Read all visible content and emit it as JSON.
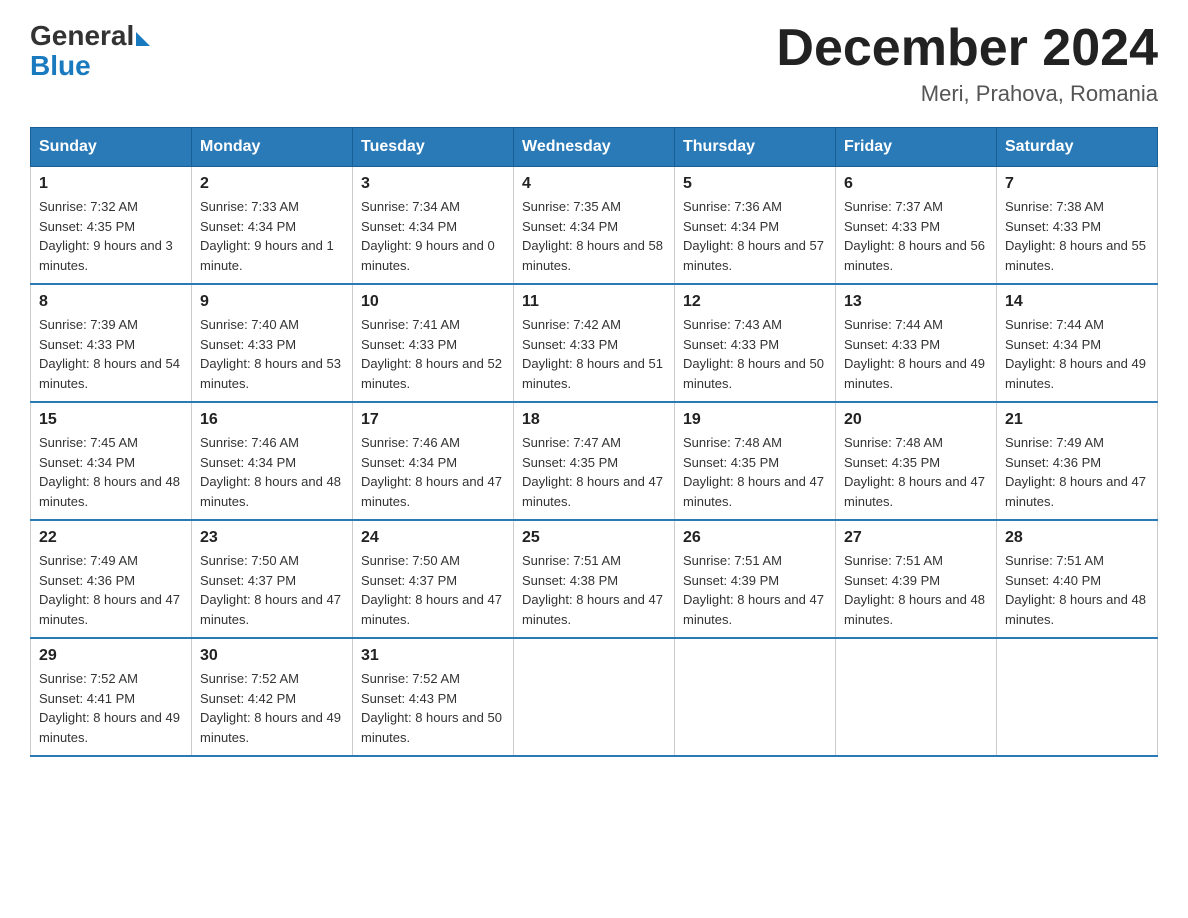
{
  "header": {
    "logo_general": "General",
    "logo_blue": "Blue",
    "title": "December 2024",
    "subtitle": "Meri, Prahova, Romania"
  },
  "days_of_week": [
    "Sunday",
    "Monday",
    "Tuesday",
    "Wednesday",
    "Thursday",
    "Friday",
    "Saturday"
  ],
  "weeks": [
    [
      {
        "day": "1",
        "sunrise": "7:32 AM",
        "sunset": "4:35 PM",
        "daylight": "9 hours and 3 minutes."
      },
      {
        "day": "2",
        "sunrise": "7:33 AM",
        "sunset": "4:34 PM",
        "daylight": "9 hours and 1 minute."
      },
      {
        "day": "3",
        "sunrise": "7:34 AM",
        "sunset": "4:34 PM",
        "daylight": "9 hours and 0 minutes."
      },
      {
        "day": "4",
        "sunrise": "7:35 AM",
        "sunset": "4:34 PM",
        "daylight": "8 hours and 58 minutes."
      },
      {
        "day": "5",
        "sunrise": "7:36 AM",
        "sunset": "4:34 PM",
        "daylight": "8 hours and 57 minutes."
      },
      {
        "day": "6",
        "sunrise": "7:37 AM",
        "sunset": "4:33 PM",
        "daylight": "8 hours and 56 minutes."
      },
      {
        "day": "7",
        "sunrise": "7:38 AM",
        "sunset": "4:33 PM",
        "daylight": "8 hours and 55 minutes."
      }
    ],
    [
      {
        "day": "8",
        "sunrise": "7:39 AM",
        "sunset": "4:33 PM",
        "daylight": "8 hours and 54 minutes."
      },
      {
        "day": "9",
        "sunrise": "7:40 AM",
        "sunset": "4:33 PM",
        "daylight": "8 hours and 53 minutes."
      },
      {
        "day": "10",
        "sunrise": "7:41 AM",
        "sunset": "4:33 PM",
        "daylight": "8 hours and 52 minutes."
      },
      {
        "day": "11",
        "sunrise": "7:42 AM",
        "sunset": "4:33 PM",
        "daylight": "8 hours and 51 minutes."
      },
      {
        "day": "12",
        "sunrise": "7:43 AM",
        "sunset": "4:33 PM",
        "daylight": "8 hours and 50 minutes."
      },
      {
        "day": "13",
        "sunrise": "7:44 AM",
        "sunset": "4:33 PM",
        "daylight": "8 hours and 49 minutes."
      },
      {
        "day": "14",
        "sunrise": "7:44 AM",
        "sunset": "4:34 PM",
        "daylight": "8 hours and 49 minutes."
      }
    ],
    [
      {
        "day": "15",
        "sunrise": "7:45 AM",
        "sunset": "4:34 PM",
        "daylight": "8 hours and 48 minutes."
      },
      {
        "day": "16",
        "sunrise": "7:46 AM",
        "sunset": "4:34 PM",
        "daylight": "8 hours and 48 minutes."
      },
      {
        "day": "17",
        "sunrise": "7:46 AM",
        "sunset": "4:34 PM",
        "daylight": "8 hours and 47 minutes."
      },
      {
        "day": "18",
        "sunrise": "7:47 AM",
        "sunset": "4:35 PM",
        "daylight": "8 hours and 47 minutes."
      },
      {
        "day": "19",
        "sunrise": "7:48 AM",
        "sunset": "4:35 PM",
        "daylight": "8 hours and 47 minutes."
      },
      {
        "day": "20",
        "sunrise": "7:48 AM",
        "sunset": "4:35 PM",
        "daylight": "8 hours and 47 minutes."
      },
      {
        "day": "21",
        "sunrise": "7:49 AM",
        "sunset": "4:36 PM",
        "daylight": "8 hours and 47 minutes."
      }
    ],
    [
      {
        "day": "22",
        "sunrise": "7:49 AM",
        "sunset": "4:36 PM",
        "daylight": "8 hours and 47 minutes."
      },
      {
        "day": "23",
        "sunrise": "7:50 AM",
        "sunset": "4:37 PM",
        "daylight": "8 hours and 47 minutes."
      },
      {
        "day": "24",
        "sunrise": "7:50 AM",
        "sunset": "4:37 PM",
        "daylight": "8 hours and 47 minutes."
      },
      {
        "day": "25",
        "sunrise": "7:51 AM",
        "sunset": "4:38 PM",
        "daylight": "8 hours and 47 minutes."
      },
      {
        "day": "26",
        "sunrise": "7:51 AM",
        "sunset": "4:39 PM",
        "daylight": "8 hours and 47 minutes."
      },
      {
        "day": "27",
        "sunrise": "7:51 AM",
        "sunset": "4:39 PM",
        "daylight": "8 hours and 48 minutes."
      },
      {
        "day": "28",
        "sunrise": "7:51 AM",
        "sunset": "4:40 PM",
        "daylight": "8 hours and 48 minutes."
      }
    ],
    [
      {
        "day": "29",
        "sunrise": "7:52 AM",
        "sunset": "4:41 PM",
        "daylight": "8 hours and 49 minutes."
      },
      {
        "day": "30",
        "sunrise": "7:52 AM",
        "sunset": "4:42 PM",
        "daylight": "8 hours and 49 minutes."
      },
      {
        "day": "31",
        "sunrise": "7:52 AM",
        "sunset": "4:43 PM",
        "daylight": "8 hours and 50 minutes."
      },
      null,
      null,
      null,
      null
    ]
  ],
  "labels": {
    "sunrise_prefix": "Sunrise: ",
    "sunset_prefix": "Sunset: ",
    "daylight_prefix": "Daylight: "
  }
}
